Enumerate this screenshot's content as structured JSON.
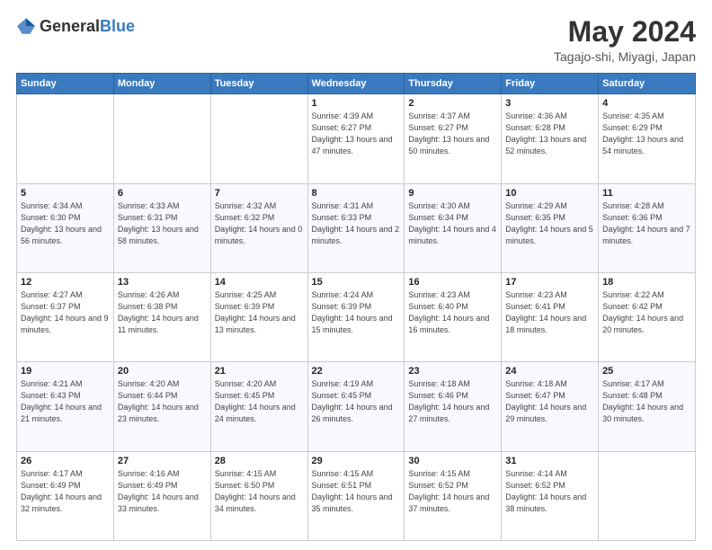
{
  "header": {
    "logo_general": "General",
    "logo_blue": "Blue",
    "month_year": "May 2024",
    "location": "Tagajo-shi, Miyagi, Japan"
  },
  "columns": [
    "Sunday",
    "Monday",
    "Tuesday",
    "Wednesday",
    "Thursday",
    "Friday",
    "Saturday"
  ],
  "weeks": [
    [
      {
        "day": "",
        "sunrise": "",
        "sunset": "",
        "daylight": ""
      },
      {
        "day": "",
        "sunrise": "",
        "sunset": "",
        "daylight": ""
      },
      {
        "day": "",
        "sunrise": "",
        "sunset": "",
        "daylight": ""
      },
      {
        "day": "1",
        "sunrise": "4:39 AM",
        "sunset": "6:27 PM",
        "daylight": "13 hours and 47 minutes."
      },
      {
        "day": "2",
        "sunrise": "4:37 AM",
        "sunset": "6:27 PM",
        "daylight": "13 hours and 50 minutes."
      },
      {
        "day": "3",
        "sunrise": "4:36 AM",
        "sunset": "6:28 PM",
        "daylight": "13 hours and 52 minutes."
      },
      {
        "day": "4",
        "sunrise": "4:35 AM",
        "sunset": "6:29 PM",
        "daylight": "13 hours and 54 minutes."
      }
    ],
    [
      {
        "day": "5",
        "sunrise": "4:34 AM",
        "sunset": "6:30 PM",
        "daylight": "13 hours and 56 minutes."
      },
      {
        "day": "6",
        "sunrise": "4:33 AM",
        "sunset": "6:31 PM",
        "daylight": "13 hours and 58 minutes."
      },
      {
        "day": "7",
        "sunrise": "4:32 AM",
        "sunset": "6:32 PM",
        "daylight": "14 hours and 0 minutes."
      },
      {
        "day": "8",
        "sunrise": "4:31 AM",
        "sunset": "6:33 PM",
        "daylight": "14 hours and 2 minutes."
      },
      {
        "day": "9",
        "sunrise": "4:30 AM",
        "sunset": "6:34 PM",
        "daylight": "14 hours and 4 minutes."
      },
      {
        "day": "10",
        "sunrise": "4:29 AM",
        "sunset": "6:35 PM",
        "daylight": "14 hours and 5 minutes."
      },
      {
        "day": "11",
        "sunrise": "4:28 AM",
        "sunset": "6:36 PM",
        "daylight": "14 hours and 7 minutes."
      }
    ],
    [
      {
        "day": "12",
        "sunrise": "4:27 AM",
        "sunset": "6:37 PM",
        "daylight": "14 hours and 9 minutes."
      },
      {
        "day": "13",
        "sunrise": "4:26 AM",
        "sunset": "6:38 PM",
        "daylight": "14 hours and 11 minutes."
      },
      {
        "day": "14",
        "sunrise": "4:25 AM",
        "sunset": "6:39 PM",
        "daylight": "14 hours and 13 minutes."
      },
      {
        "day": "15",
        "sunrise": "4:24 AM",
        "sunset": "6:39 PM",
        "daylight": "14 hours and 15 minutes."
      },
      {
        "day": "16",
        "sunrise": "4:23 AM",
        "sunset": "6:40 PM",
        "daylight": "14 hours and 16 minutes."
      },
      {
        "day": "17",
        "sunrise": "4:23 AM",
        "sunset": "6:41 PM",
        "daylight": "14 hours and 18 minutes."
      },
      {
        "day": "18",
        "sunrise": "4:22 AM",
        "sunset": "6:42 PM",
        "daylight": "14 hours and 20 minutes."
      }
    ],
    [
      {
        "day": "19",
        "sunrise": "4:21 AM",
        "sunset": "6:43 PM",
        "daylight": "14 hours and 21 minutes."
      },
      {
        "day": "20",
        "sunrise": "4:20 AM",
        "sunset": "6:44 PM",
        "daylight": "14 hours and 23 minutes."
      },
      {
        "day": "21",
        "sunrise": "4:20 AM",
        "sunset": "6:45 PM",
        "daylight": "14 hours and 24 minutes."
      },
      {
        "day": "22",
        "sunrise": "4:19 AM",
        "sunset": "6:45 PM",
        "daylight": "14 hours and 26 minutes."
      },
      {
        "day": "23",
        "sunrise": "4:18 AM",
        "sunset": "6:46 PM",
        "daylight": "14 hours and 27 minutes."
      },
      {
        "day": "24",
        "sunrise": "4:18 AM",
        "sunset": "6:47 PM",
        "daylight": "14 hours and 29 minutes."
      },
      {
        "day": "25",
        "sunrise": "4:17 AM",
        "sunset": "6:48 PM",
        "daylight": "14 hours and 30 minutes."
      }
    ],
    [
      {
        "day": "26",
        "sunrise": "4:17 AM",
        "sunset": "6:49 PM",
        "daylight": "14 hours and 32 minutes."
      },
      {
        "day": "27",
        "sunrise": "4:16 AM",
        "sunset": "6:49 PM",
        "daylight": "14 hours and 33 minutes."
      },
      {
        "day": "28",
        "sunrise": "4:15 AM",
        "sunset": "6:50 PM",
        "daylight": "14 hours and 34 minutes."
      },
      {
        "day": "29",
        "sunrise": "4:15 AM",
        "sunset": "6:51 PM",
        "daylight": "14 hours and 35 minutes."
      },
      {
        "day": "30",
        "sunrise": "4:15 AM",
        "sunset": "6:52 PM",
        "daylight": "14 hours and 37 minutes."
      },
      {
        "day": "31",
        "sunrise": "4:14 AM",
        "sunset": "6:52 PM",
        "daylight": "14 hours and 38 minutes."
      },
      {
        "day": "",
        "sunrise": "",
        "sunset": "",
        "daylight": ""
      }
    ]
  ]
}
